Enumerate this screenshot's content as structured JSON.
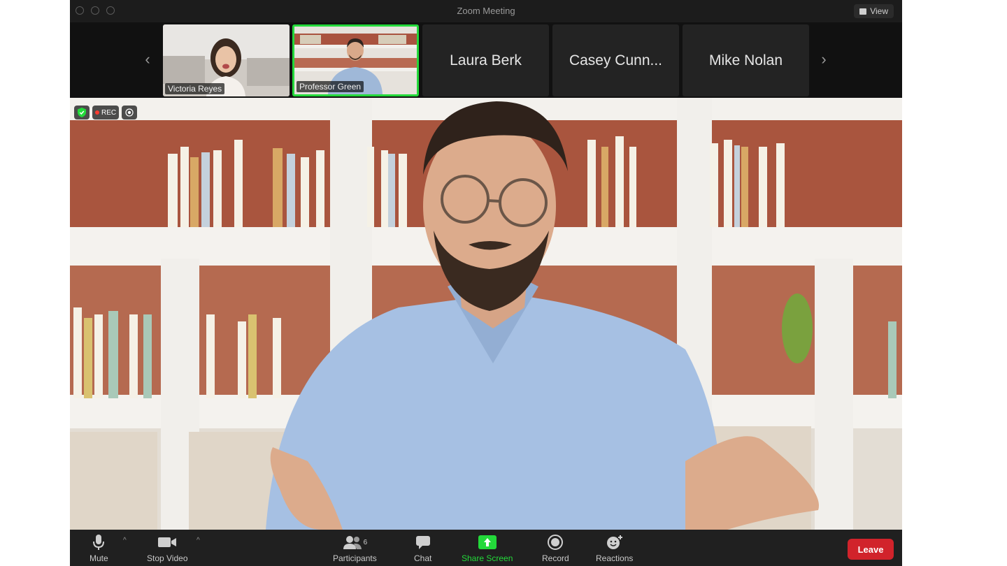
{
  "window": {
    "title": "Zoom Meeting",
    "view_label": "View"
  },
  "thumbnails": [
    {
      "name": "Victoria Reyes",
      "video": true,
      "active": false
    },
    {
      "name": "Professor Green",
      "video": true,
      "active": true
    },
    {
      "name": "Laura Berk",
      "video": false,
      "active": false
    },
    {
      "name": "Casey Cunn...",
      "video": false,
      "active": false
    },
    {
      "name": "Mike Nolan",
      "video": false,
      "active": false
    }
  ],
  "status": {
    "rec_label": "REC"
  },
  "toolbar": {
    "mute": "Mute",
    "stop_video": "Stop Video",
    "participants": "Participants",
    "participants_count": "6",
    "chat": "Chat",
    "share_screen": "Share Screen",
    "record": "Record",
    "reactions": "Reactions",
    "leave": "Leave"
  },
  "colors": {
    "active_speaker_border": "#23d93a",
    "share_screen": "#23d93a",
    "leave_button": "#d1232b",
    "toolbar_bg": "#202020"
  }
}
